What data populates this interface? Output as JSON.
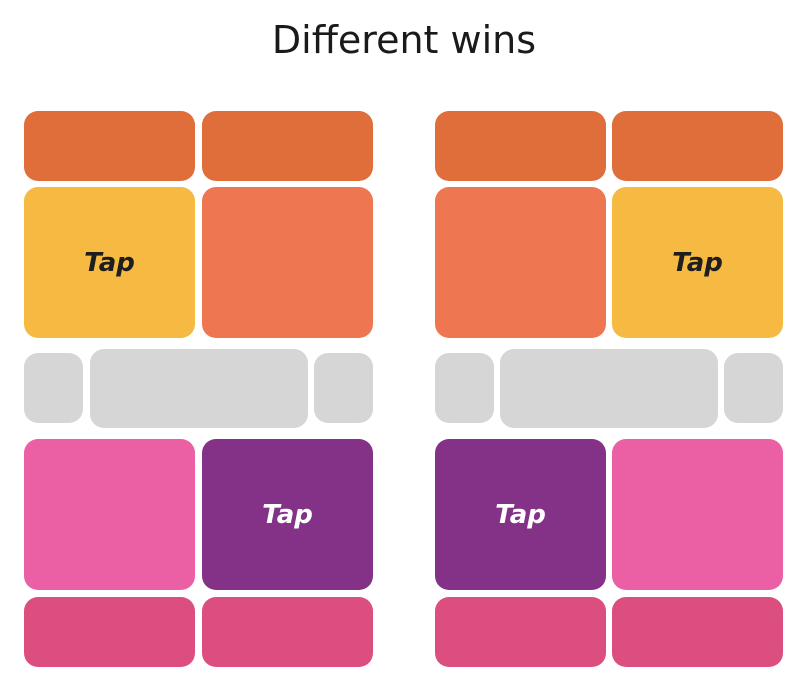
{
  "title": "Different wins",
  "colors": {
    "orange_dark": "#e06e3a",
    "orange": "#ee7651",
    "yellow": "#f6ba42",
    "gray": "#d6d6d6",
    "pink": "#eb5fa5",
    "purple": "#833287",
    "pink_dark": "#dc4e80",
    "tap_dark_text": "#1e1e1e",
    "tap_light_text": "#ffffff"
  },
  "left_panel": {
    "tap_top_label": "Tap",
    "tap_bottom_label": "Tap"
  },
  "right_panel": {
    "tap_top_label": "Tap",
    "tap_bottom_label": "Tap"
  }
}
